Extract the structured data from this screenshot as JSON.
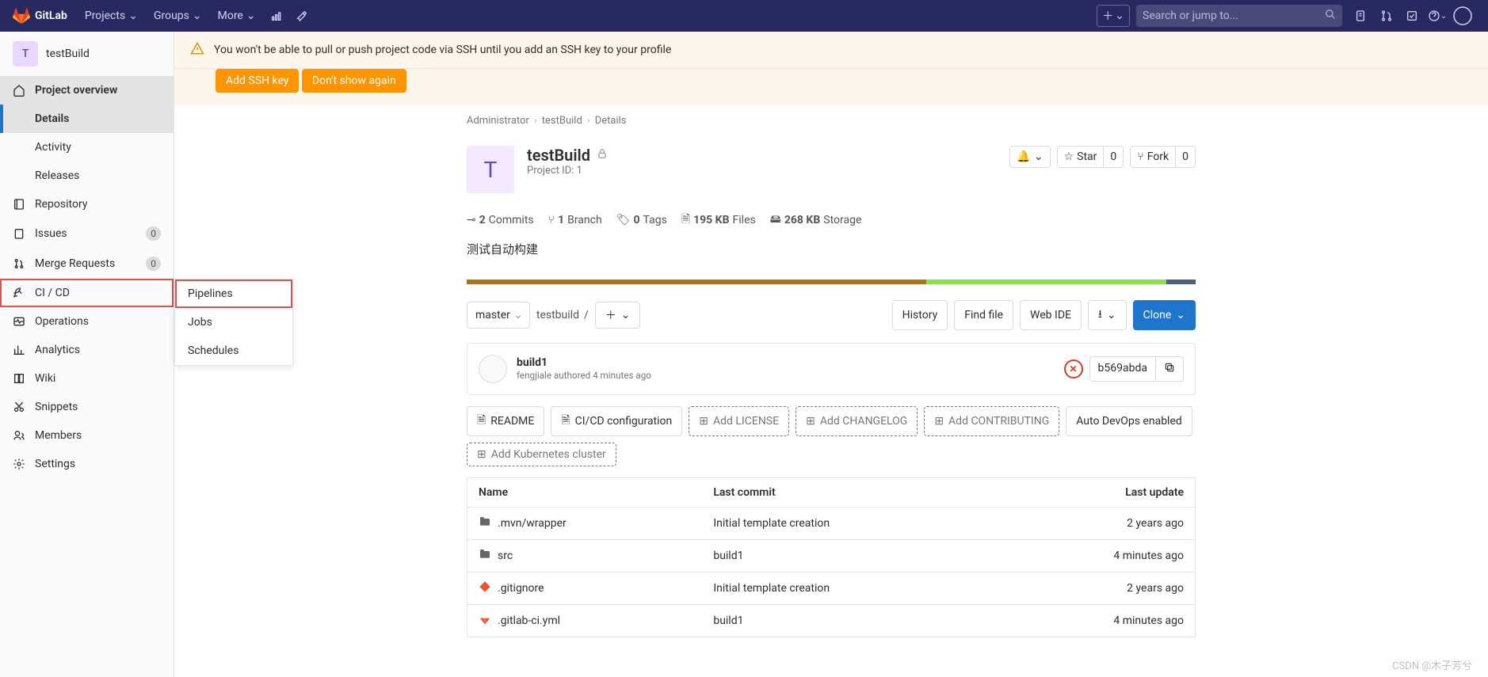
{
  "topnav": {
    "brand": "GitLab",
    "items": [
      "Projects",
      "Groups",
      "More"
    ],
    "search_placeholder": "Search or jump to..."
  },
  "sidebar": {
    "project_avatar": "T",
    "project_name": "testBuild",
    "project_overview": "Project overview",
    "overview_sub": [
      "Details",
      "Activity",
      "Releases"
    ],
    "items": [
      {
        "label": "Repository"
      },
      {
        "label": "Issues",
        "badge": "0"
      },
      {
        "label": "Merge Requests",
        "badge": "0"
      },
      {
        "label": "CI / CD"
      },
      {
        "label": "Operations"
      },
      {
        "label": "Analytics"
      },
      {
        "label": "Wiki"
      },
      {
        "label": "Snippets"
      },
      {
        "label": "Members"
      },
      {
        "label": "Settings"
      }
    ],
    "flyout": [
      "Pipelines",
      "Jobs",
      "Schedules"
    ]
  },
  "alert": {
    "text": "You won't be able to pull or push project code via SSH until you add an SSH key to your profile",
    "add_btn": "Add SSH key",
    "dismiss_btn": "Don't show again"
  },
  "breadcrumb": [
    "Administrator",
    "testBuild",
    "Details"
  ],
  "project": {
    "avatar": "T",
    "name": "testBuild",
    "id": "Project ID: 1",
    "star": "Star",
    "star_count": "0",
    "fork": "Fork",
    "fork_count": "0"
  },
  "stats": {
    "commits_n": "2",
    "commits": "Commits",
    "branch_n": "1",
    "branch": "Branch",
    "tags_n": "0",
    "tags": "Tags",
    "files_n": "195 KB",
    "files": "Files",
    "storage_n": "268 KB",
    "storage": "Storage"
  },
  "description": "测试自动构建",
  "toolbar": {
    "branch": "master",
    "path": "testbuild",
    "history": "History",
    "findfile": "Find file",
    "webide": "Web IDE",
    "clone": "Clone"
  },
  "commit": {
    "title": "build1",
    "author": "fengjiale authored 4 minutes ago",
    "sha": "b569abda"
  },
  "chips": {
    "readme": "README",
    "cicd": "CI/CD configuration",
    "license": "Add LICENSE",
    "changelog": "Add CHANGELOG",
    "contributing": "Add CONTRIBUTING",
    "autodevops": "Auto DevOps enabled",
    "k8s": "Add Kubernetes cluster"
  },
  "table": {
    "h_name": "Name",
    "h_commit": "Last commit",
    "h_update": "Last update",
    "rows": [
      {
        "icon": "folder",
        "name": ".mvn/wrapper",
        "commit": "Initial template creation",
        "update": "2 years ago"
      },
      {
        "icon": "folder",
        "name": "src",
        "commit": "build1",
        "update": "4 minutes ago"
      },
      {
        "icon": "gitignore",
        "name": ".gitignore",
        "commit": "Initial template creation",
        "update": "2 years ago"
      },
      {
        "icon": "gitlab",
        "name": ".gitlab-ci.yml",
        "commit": "build1",
        "update": "4 minutes ago"
      }
    ]
  },
  "watermark": "CSDN @木子芳兮"
}
